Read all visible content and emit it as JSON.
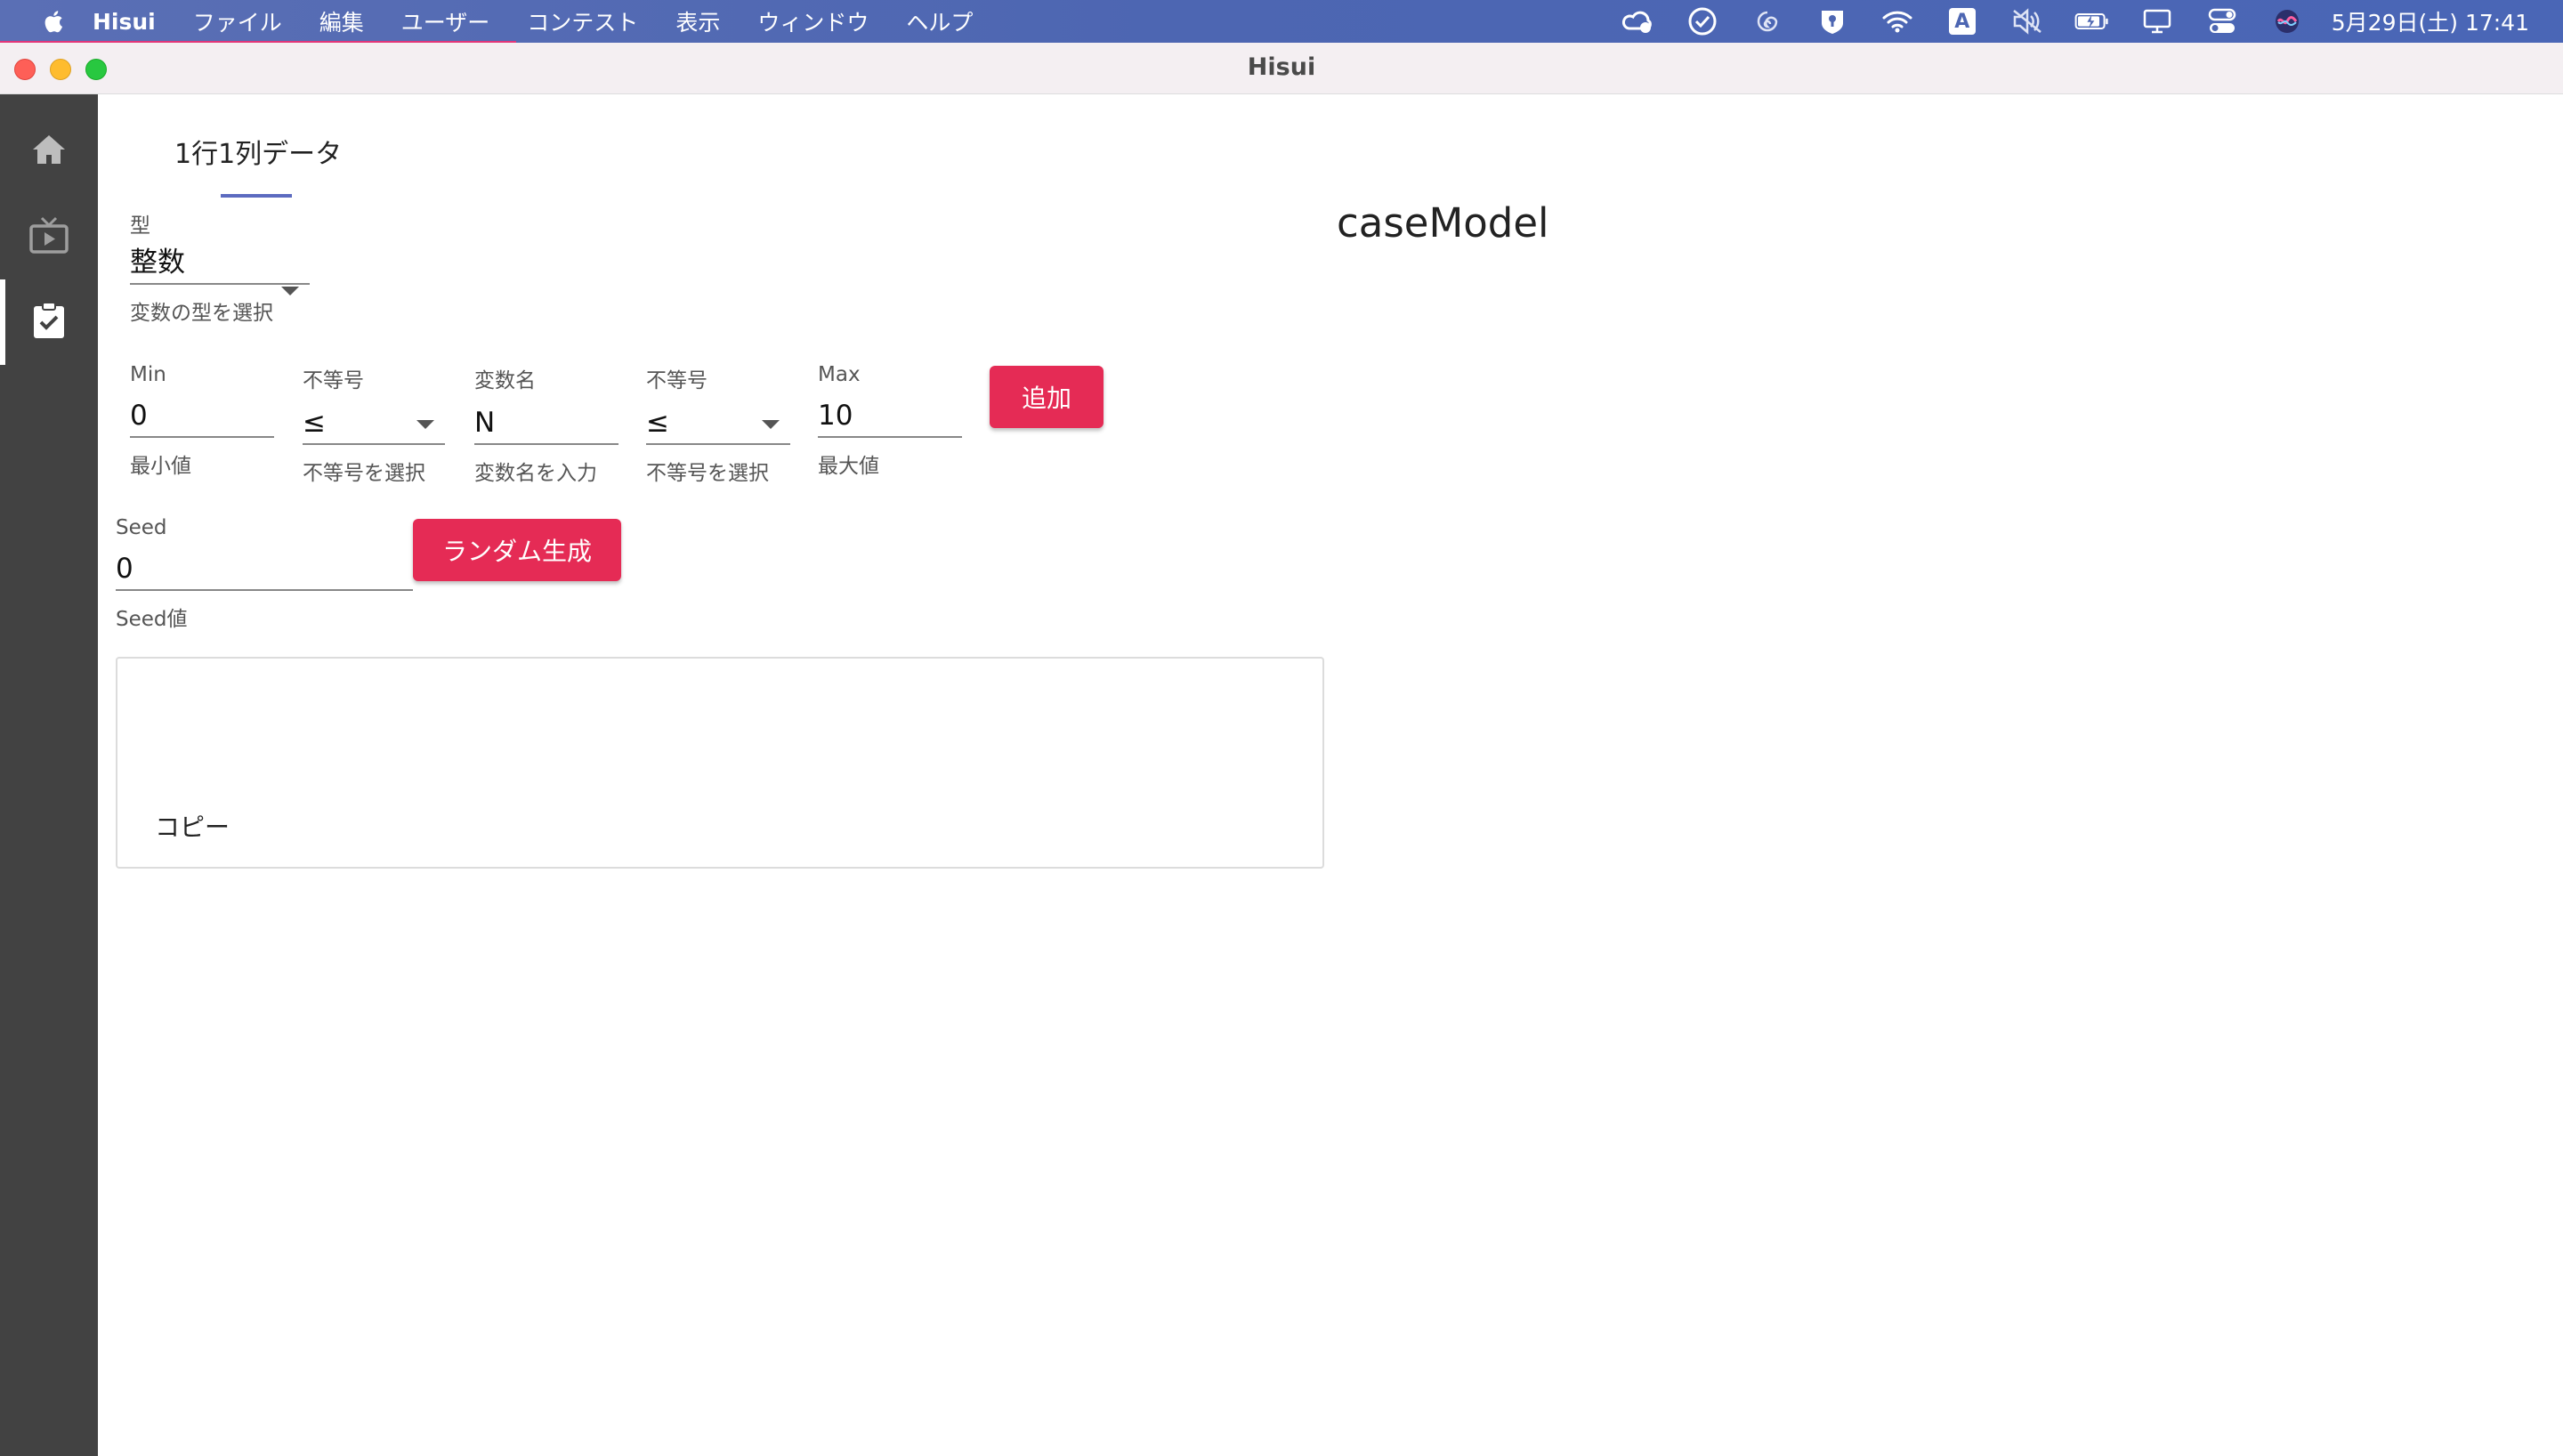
{
  "menubar": {
    "app_name": "Hisui",
    "items": [
      "ファイル",
      "編集",
      "ユーザー",
      "コンテスト",
      "表示",
      "ウィンドウ",
      "ヘルプ"
    ],
    "status_icons": [
      "creative-cloud-icon",
      "check-circle-icon",
      "swirl-icon",
      "password-manager-icon",
      "wifi-icon",
      "input-source-icon",
      "mute-icon",
      "battery-icon",
      "display-icon",
      "control-center-icon",
      "siri-icon"
    ],
    "input_source_label": "A",
    "clock": "5月29日(土)  17:41"
  },
  "window": {
    "title": "Hisui"
  },
  "sidebar": {
    "items": [
      "home-icon",
      "live-tv-icon",
      "assignment-turned-in-icon"
    ]
  },
  "tabs": {
    "active": "1行1列データ"
  },
  "case_title": "caseModel",
  "type_field": {
    "label": "型",
    "value": "整数",
    "helper": "変数の型を選択"
  },
  "min_field": {
    "label": "Min",
    "value": "0",
    "helper": "最小値"
  },
  "ineq1_field": {
    "label": "不等号",
    "value": "≤",
    "helper": "不等号を選択"
  },
  "var_field": {
    "label": "変数名",
    "value": "N",
    "helper": "変数名を入力"
  },
  "ineq2_field": {
    "label": "不等号",
    "value": "≤",
    "helper": "不等号を選択"
  },
  "max_field": {
    "label": "Max",
    "value": "10",
    "helper": "最大値"
  },
  "add_button": "追加",
  "seed_field": {
    "label": "Seed",
    "value": "0",
    "helper": "Seed値"
  },
  "random_button": "ランダム生成",
  "output": {
    "copy_label": "コピー"
  },
  "colors": {
    "accent": "#e52b55",
    "indicator": "#5c6bc0",
    "sidebar": "#424242"
  }
}
